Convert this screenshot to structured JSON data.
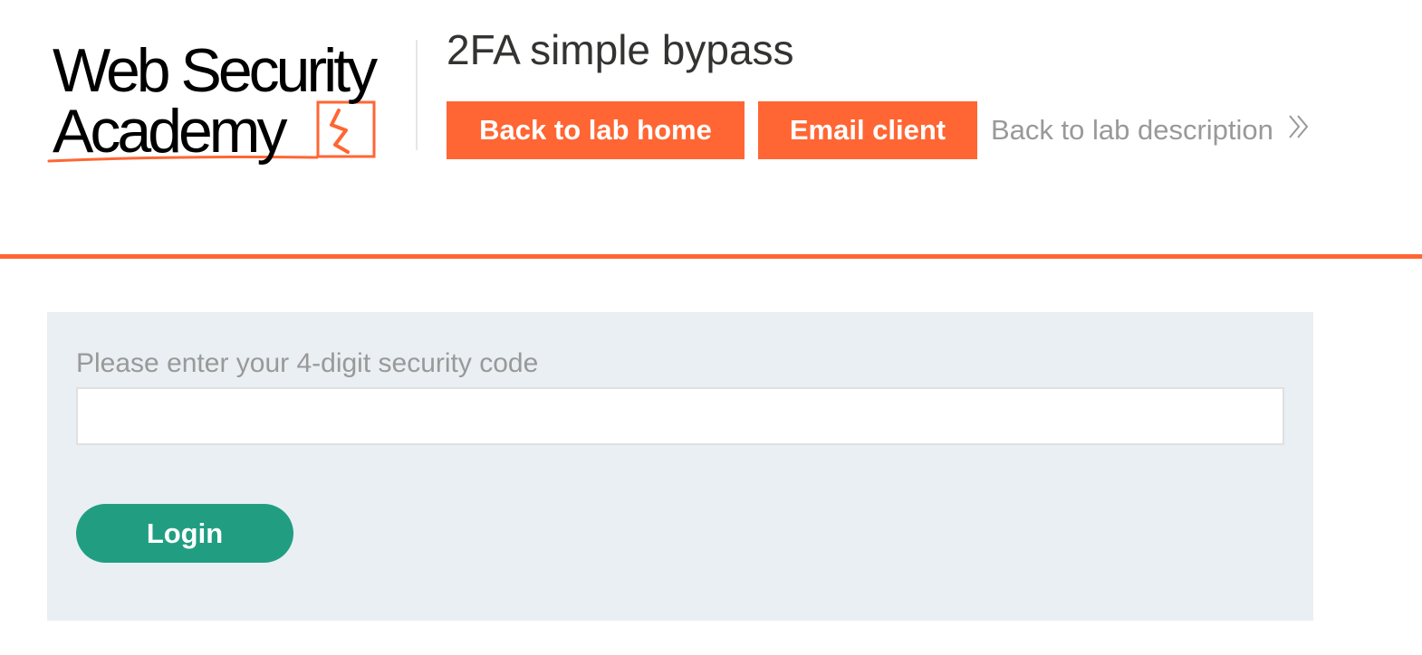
{
  "logo": {
    "line1": "Web Security",
    "line2": "Academy",
    "mark_icon": "lightning-bolt-icon"
  },
  "header": {
    "lab_title": "2FA simple bypass",
    "back_to_lab_home": "Back to lab home",
    "email_client": "Email client",
    "back_to_lab_description": "Back to lab description",
    "chevron_icon": "double-chevron-right-icon"
  },
  "form": {
    "label": "Please enter your 4-digit security code",
    "input_value": "",
    "submit_label": "Login"
  },
  "colors": {
    "accent": "#ff6633",
    "button_green": "#219e82",
    "panel_bg": "#e9eff2",
    "muted_text": "#999999"
  }
}
